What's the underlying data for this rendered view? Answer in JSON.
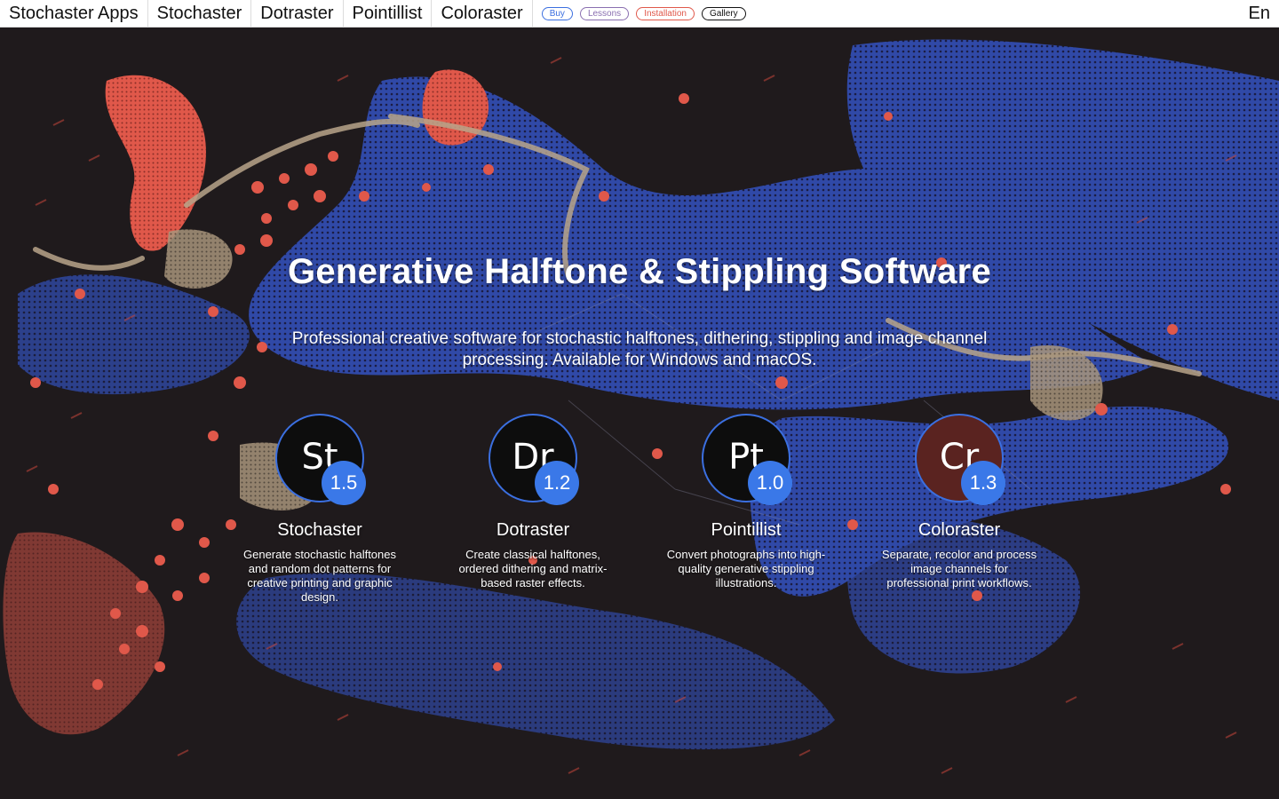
{
  "nav": {
    "brand": "Stochaster Apps",
    "items": [
      "Stochaster",
      "Dotraster",
      "Pointillist",
      "Coloraster"
    ],
    "pills": [
      "Buy",
      "Lessons",
      "Installation",
      "Gallery"
    ],
    "language": "En"
  },
  "hero": {
    "title": "Generative Halftone & Stippling Software",
    "subtitle": "Professional creative software for stochastic halftones, dithering, stippling and image channel processing. Available for Windows and macOS."
  },
  "apps": [
    {
      "monogram": "St",
      "version": "1.5",
      "name": "Stochaster",
      "description": "Generate stochastic halftones and random dot patterns for creative printing and graphic design."
    },
    {
      "monogram": "Dr",
      "version": "1.2",
      "name": "Dotraster",
      "description": "Create classical halftones, ordered dithering and matrix-based raster effects."
    },
    {
      "monogram": "Pt",
      "version": "1.0",
      "name": "Pointillist",
      "description": "Convert photographs into high-quality generative stippling illustrations."
    },
    {
      "monogram": "Cr",
      "version": "1.3",
      "name": "Coloraster",
      "description": "Separate, recolor and process image channels for professional print workflows."
    }
  ],
  "colors": {
    "background": "#1f1a1c",
    "blue": "#3b58c4",
    "red": "#e0584a",
    "tan": "#b8a58a",
    "badge": "#3a78e8"
  }
}
